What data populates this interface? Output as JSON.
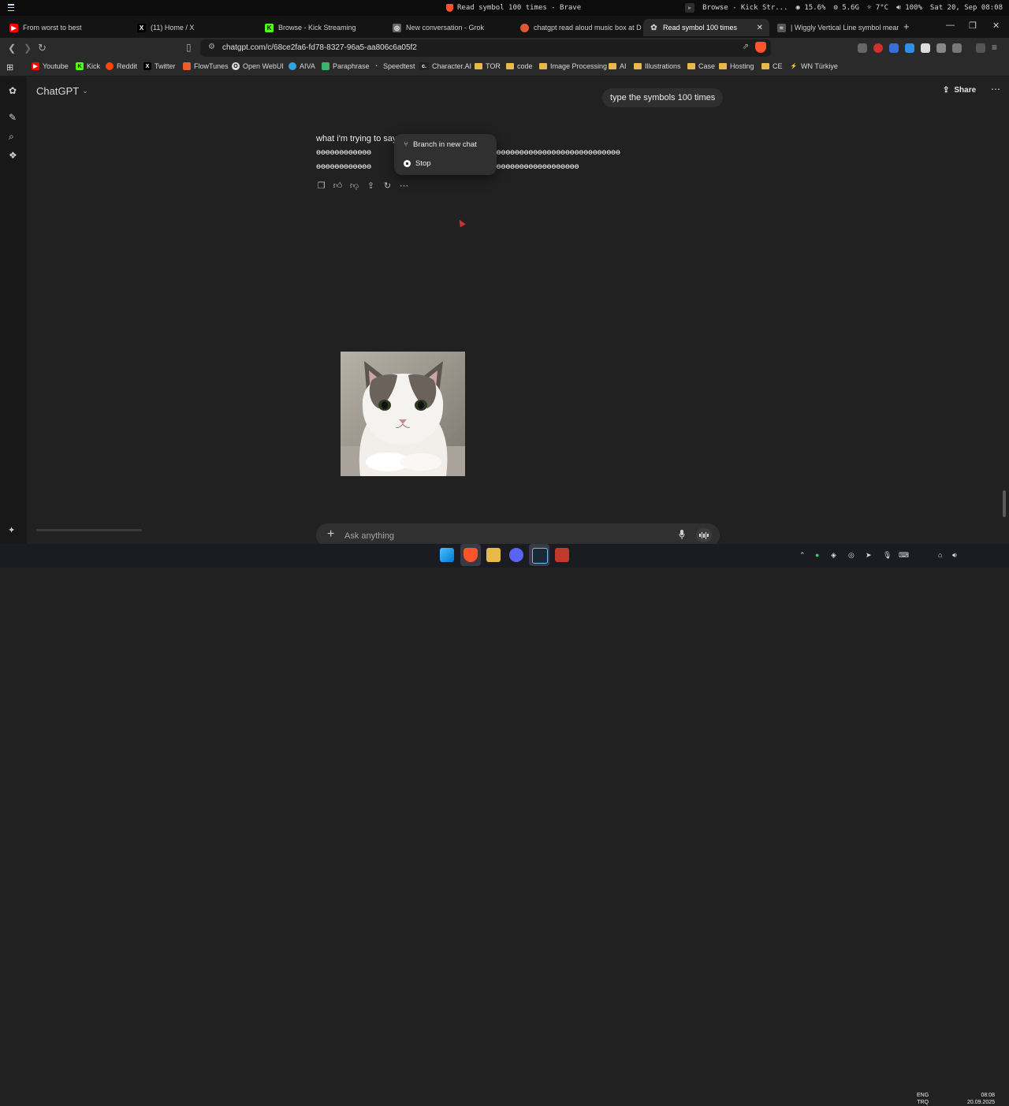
{
  "system_bar": {
    "window_title": "Read symbol 100 times - Brave",
    "secondary_title": "Browse - Kick Str...",
    "cpu": "15.6%",
    "mem": "5.6G",
    "temp": "7°C",
    "volume": "100%",
    "datetime": "Sat 20, Sep 08:08"
  },
  "tabs": [
    {
      "title": "From worst to best",
      "icon": "youtube-icon",
      "color": "#ff0000"
    },
    {
      "title": "(11) Home / X",
      "icon": "x-icon",
      "color": "#000000"
    },
    {
      "title": "Browse - Kick Streaming",
      "icon": "kick-icon",
      "color": "#53fc18"
    },
    {
      "title": "New conversation - Grok",
      "icon": "grok-icon",
      "color": "#888888"
    },
    {
      "title": "chatgpt read aloud music box at Du",
      "icon": "duckduckgo-icon",
      "color": "#de5833"
    },
    {
      "title": "Read symbol 100 times",
      "icon": "chatgpt-icon",
      "color": "#cccccc",
      "active": true
    },
    {
      "title": "| Wiggly Vertical Line symbol meani",
      "icon": "page-icon",
      "color": "#888888"
    }
  ],
  "address_bar": {
    "url": "chatgpt.com/c/68ce2fa6-fd78-8327-96a5-aa806c6a05f2"
  },
  "bookmarks": [
    {
      "label": "Youtube",
      "icon": "youtube-icon",
      "color": "#ff0000"
    },
    {
      "label": "Kick",
      "icon": "kick-icon",
      "color": "#53fc18"
    },
    {
      "label": "Reddit",
      "icon": "reddit-icon",
      "color": "#ff4500"
    },
    {
      "label": "Twitter",
      "icon": "x-icon",
      "color": "#000000"
    },
    {
      "label": "FlowTunes",
      "icon": "flowtunes-icon",
      "color": "#e85d2a"
    },
    {
      "label": "Open WebUI",
      "icon": "webui-icon",
      "color": "#dddddd"
    },
    {
      "label": "AIVA",
      "icon": "aiva-icon",
      "color": "#2fa3e6"
    },
    {
      "label": "Paraphrase",
      "icon": "paraphrase-icon",
      "color": "#3bb36c"
    },
    {
      "label": "Speedtest",
      "icon": "speedtest-icon",
      "color": "#dddddd"
    },
    {
      "label": "Character.AI",
      "icon": "characterai-icon",
      "color": "#222222"
    },
    {
      "label": "TOR",
      "icon": "folder-icon"
    },
    {
      "label": "code",
      "icon": "folder-icon"
    },
    {
      "label": "Image Processing",
      "icon": "folder-icon"
    },
    {
      "label": "AI",
      "icon": "folder-icon"
    },
    {
      "label": "Illustrations",
      "icon": "folder-icon"
    },
    {
      "label": "Case",
      "icon": "folder-icon"
    },
    {
      "label": "Hosting",
      "icon": "folder-icon"
    },
    {
      "label": "CE",
      "icon": "folder-icon"
    },
    {
      "label": "WN Türkiye",
      "icon": "wn-icon",
      "color": "#dddddd"
    }
  ],
  "app": {
    "title": "ChatGPT",
    "share_label": "Share"
  },
  "chat": {
    "user_message": "type the symbols 100 times",
    "response_intro": "what i'm trying to say",
    "response_line1_left": "ѳѳѳѳѳѳѳѳѳѳѳѳ",
    "response_line1_right": "ѳѳѳѳѳѳѳѳѳѳѳѳѳѳѳѳѳѳѳѳѳѳѳѳѳѳѳѳѳѳѳѳѳѳ",
    "response_line2_left": "ѳѳѳѳѳѳѳѳѳѳѳѳ",
    "response_line2_right": "ѳѳѳѳѳѳѳѳѳѳѳѳѳѳѳѳѳѳѳѳѳѳѳѳѳ"
  },
  "popup_menu": {
    "branch_label": "Branch in new chat",
    "stop_label": "Stop"
  },
  "composer": {
    "placeholder": "Ask anything"
  },
  "taskbar": {
    "lang_top": "ENG",
    "lang_bottom": "TRQ",
    "time": "08:08",
    "date": "20.09.2025"
  }
}
